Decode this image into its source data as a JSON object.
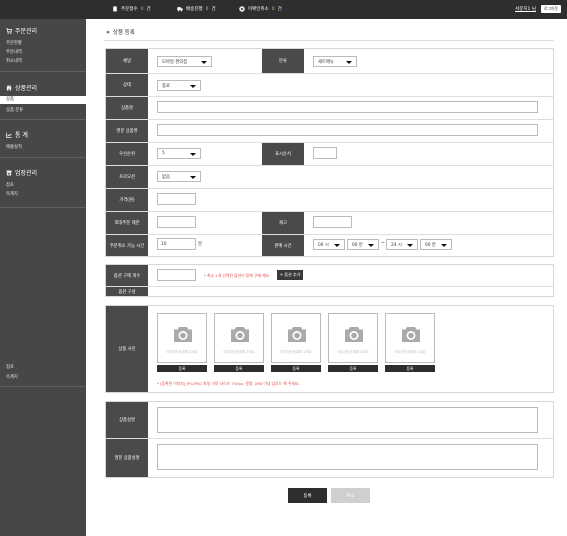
{
  "topbar": {
    "stats": [
      {
        "icon": "clipboard-icon",
        "label": "주문접수",
        "value": "0",
        "unit": "건"
      },
      {
        "icon": "truck-icon",
        "label": "배송진행",
        "value": "0",
        "unit": "건"
      },
      {
        "icon": "cancel-circle-icon",
        "label": "미확인취소",
        "value": "0",
        "unit": "건"
      }
    ],
    "user_link": "서문지1 님",
    "logout_label": "로그아웃",
    "accent_color": "#8bd16a"
  },
  "sidebar": {
    "sections": [
      {
        "icon": "cart-icon",
        "title": "주문관리",
        "items": [
          "주문현황",
          "주문내역",
          "취소내역"
        ]
      },
      {
        "icon": "store-icon",
        "title": "상품관리",
        "items": [
          "상품",
          "상품 분류"
        ],
        "active": "상품"
      },
      {
        "icon": "chart-icon",
        "title": "통 계",
        "items": [
          "매출실적"
        ]
      },
      {
        "icon": "shop-icon",
        "title": "업장관리",
        "items": [
          "점포",
          "옥계지"
        ]
      }
    ],
    "bottom_items": [
      "점포",
      "옥계지"
    ]
  },
  "page": {
    "title": "상품 등록",
    "chevrons": "»"
  },
  "form": {
    "channel": {
      "label": "채널",
      "value": "모바일 편의점"
    },
    "category": {
      "label": "분류",
      "value": "세트메뉴"
    },
    "status": {
      "label": "상태",
      "value": "종료"
    },
    "name": {
      "label": "상품명",
      "value": ""
    },
    "name_en": {
      "label": "영문 상품명",
      "value": ""
    },
    "priority": {
      "label": "우선순위",
      "value": "5"
    },
    "display_order": {
      "label": "표시순서",
      "value": ""
    },
    "promotion": {
      "label": "프로모션",
      "value": "없음"
    },
    "price": {
      "label": "가격(원)",
      "value": ""
    },
    "max_order": {
      "label": "최대주문 제한",
      "value": ""
    },
    "stock": {
      "label": "재고",
      "value": ""
    },
    "cancel_time": {
      "label": "주문취소 가능 시간",
      "value": "10",
      "unit": "분"
    },
    "sale_time": {
      "label": "판매 시간",
      "start_hour": "00 시",
      "start_min": "00 분",
      "separator": "~",
      "end_hour": "24 시",
      "end_min": "00 분"
    },
    "option_count": {
      "label": "옵션 구매 개수",
      "value": "",
      "hint": "* 최소 1개 선택된 옵션이 함께 구매 해요",
      "add_button": "+ 옵션 추가"
    },
    "option_config": {
      "label": "옵션 구성"
    },
    "photos": {
      "label": "상품 사진",
      "placeholder": "이미지를 등록해 주세요",
      "button": "등록",
      "count": 5,
      "notice": "* [등록된 이미지] JPG,PNG 파일 가로 사이즈 700px, 용량 1MB 이내 업로드 해 주세요."
    },
    "description": {
      "label": "상품설명",
      "value": ""
    },
    "description_en": {
      "label": "영문 상품설명",
      "value": ""
    }
  },
  "actions": {
    "submit": "등록",
    "cancel": "취소"
  }
}
